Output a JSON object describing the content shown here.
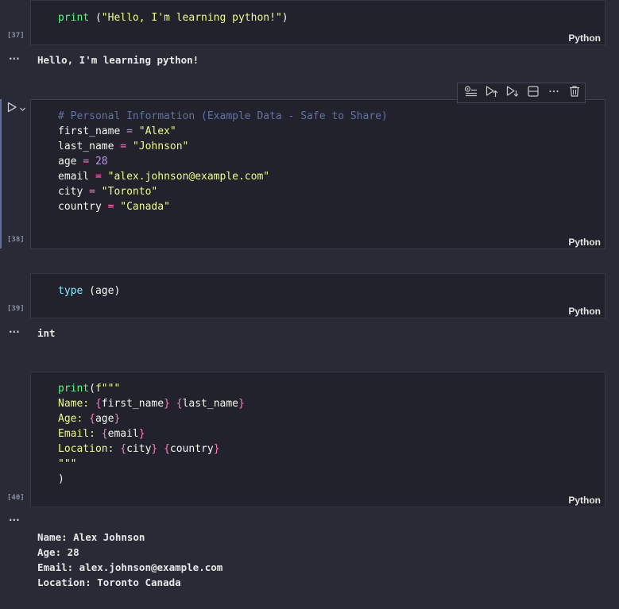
{
  "cells": [
    {
      "exec_count": "[37]",
      "language": "Python",
      "code_lines": [
        [
          {
            "t": "print",
            "c": "kw"
          },
          {
            "t": " (",
            "c": "plain"
          },
          {
            "t": "\"Hello, I'm learning python!\"",
            "c": "str"
          },
          {
            "t": ")",
            "c": "plain"
          }
        ]
      ],
      "output": "Hello, I'm learning python!"
    },
    {
      "exec_count": "[38]",
      "language": "Python",
      "code_lines": [
        [
          {
            "t": "# Personal Information (Example Data - Safe to Share)",
            "c": "cmt"
          }
        ],
        [
          {
            "t": "first_name ",
            "c": "plain"
          },
          {
            "t": "=",
            "c": "op"
          },
          {
            "t": " ",
            "c": "plain"
          },
          {
            "t": "\"Alex\"",
            "c": "str"
          }
        ],
        [
          {
            "t": "last_name ",
            "c": "plain"
          },
          {
            "t": "=",
            "c": "op"
          },
          {
            "t": " ",
            "c": "plain"
          },
          {
            "t": "\"Johnson\"",
            "c": "str"
          }
        ],
        [
          {
            "t": "age ",
            "c": "plain"
          },
          {
            "t": "=",
            "c": "op"
          },
          {
            "t": " ",
            "c": "plain"
          },
          {
            "t": "28",
            "c": "num"
          }
        ],
        [
          {
            "t": "email ",
            "c": "plain"
          },
          {
            "t": "=",
            "c": "op"
          },
          {
            "t": " ",
            "c": "plain"
          },
          {
            "t": "\"alex.johnson@example.com\"",
            "c": "str"
          }
        ],
        [
          {
            "t": "city ",
            "c": "plain"
          },
          {
            "t": "=",
            "c": "op"
          },
          {
            "t": " ",
            "c": "plain"
          },
          {
            "t": "\"Toronto\"",
            "c": "str"
          }
        ],
        [
          {
            "t": "country ",
            "c": "plain"
          },
          {
            "t": "=",
            "c": "op"
          },
          {
            "t": " ",
            "c": "plain"
          },
          {
            "t": "\"Canada\"",
            "c": "str"
          }
        ]
      ],
      "output": null
    },
    {
      "exec_count": "[39]",
      "language": "Python",
      "code_lines": [
        [
          {
            "t": "type",
            "c": "fn-blue"
          },
          {
            "t": " (age)",
            "c": "plain"
          }
        ]
      ],
      "output": "int"
    },
    {
      "exec_count": "[40]",
      "language": "Python",
      "code_lines": [
        [
          {
            "t": "print",
            "c": "kw"
          },
          {
            "t": "(",
            "c": "plain"
          },
          {
            "t": "f\"\"\"",
            "c": "str"
          }
        ],
        [
          {
            "t": "Name: ",
            "c": "str"
          },
          {
            "t": "{",
            "c": "brace"
          },
          {
            "t": "first_name",
            "c": "plain"
          },
          {
            "t": "}",
            "c": "brace"
          },
          {
            "t": " ",
            "c": "str"
          },
          {
            "t": "{",
            "c": "brace"
          },
          {
            "t": "last_name",
            "c": "plain"
          },
          {
            "t": "}",
            "c": "brace"
          }
        ],
        [
          {
            "t": "Age: ",
            "c": "str"
          },
          {
            "t": "{",
            "c": "brace"
          },
          {
            "t": "age",
            "c": "plain"
          },
          {
            "t": "}",
            "c": "brace"
          }
        ],
        [
          {
            "t": "Email: ",
            "c": "str"
          },
          {
            "t": "{",
            "c": "brace"
          },
          {
            "t": "email",
            "c": "plain"
          },
          {
            "t": "}",
            "c": "brace"
          }
        ],
        [
          {
            "t": "Location: ",
            "c": "str"
          },
          {
            "t": "{",
            "c": "brace"
          },
          {
            "t": "city",
            "c": "plain"
          },
          {
            "t": "}",
            "c": "brace"
          },
          {
            "t": " ",
            "c": "str"
          },
          {
            "t": "{",
            "c": "brace"
          },
          {
            "t": "country",
            "c": "plain"
          },
          {
            "t": "}",
            "c": "brace"
          }
        ],
        [
          {
            "t": "\"\"\"",
            "c": "str"
          }
        ],
        [
          {
            "t": ")",
            "c": "plain"
          }
        ]
      ],
      "output": "Name: Alex Johnson\nAge: 28\nEmail: alex.johnson@example.com\nLocation: Toronto Canada"
    }
  ],
  "output_marker": "...",
  "toolbar": {
    "items": [
      "execute-above-icon",
      "execute-below-icon",
      "split-cell-icon",
      "more-actions-icon",
      "delete-cell-icon",
      "run-by-line-icon"
    ]
  },
  "colors": {
    "background": "#282a36",
    "cell_background": "#21222c",
    "keyword": "#50fa7b",
    "string": "#f1fa8c",
    "number": "#bd93f9",
    "operator": "#ff79c6",
    "comment": "#6272a4",
    "builtin": "#8be9fd"
  }
}
